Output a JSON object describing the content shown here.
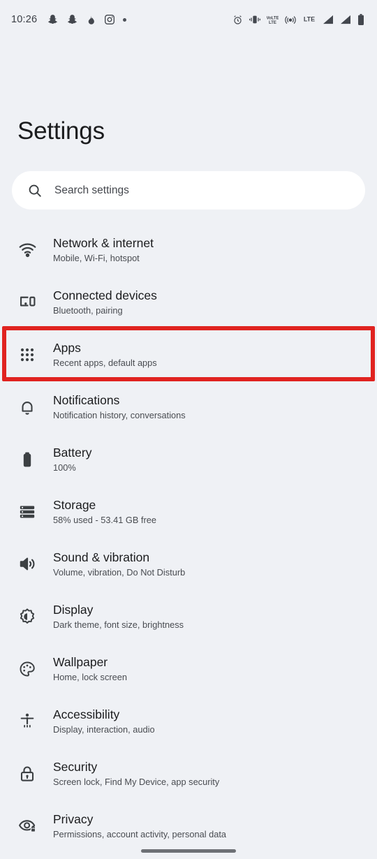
{
  "status_bar": {
    "clock": "10:26",
    "left_icons": [
      "snapchat-icon",
      "snapchat-icon",
      "flame-icon",
      "instagram-icon",
      "dot-icon"
    ],
    "right_icons": [
      "alarm-icon",
      "vibrate-icon",
      "volte-icon",
      "hotspot-icon",
      "lte-label-icon",
      "signal-bars-icon",
      "signal-bars-icon",
      "battery-icon"
    ],
    "volte_label": "VoLTE",
    "lte_label": "LTE"
  },
  "header": {
    "title": "Settings"
  },
  "search": {
    "placeholder": "Search settings",
    "value": "",
    "icon": "search-icon"
  },
  "settings_list": [
    {
      "icon": "wifi-icon",
      "title": "Network & internet",
      "subtitle": "Mobile, Wi-Fi, hotspot",
      "highlighted": false
    },
    {
      "icon": "devices-icon",
      "title": "Connected devices",
      "subtitle": "Bluetooth, pairing",
      "highlighted": false
    },
    {
      "icon": "apps-grid-icon",
      "title": "Apps",
      "subtitle": "Recent apps, default apps",
      "highlighted": true
    },
    {
      "icon": "bell-icon",
      "title": "Notifications",
      "subtitle": "Notification history, conversations",
      "highlighted": false
    },
    {
      "icon": "battery-icon",
      "title": "Battery",
      "subtitle": "100%",
      "highlighted": false
    },
    {
      "icon": "storage-icon",
      "title": "Storage",
      "subtitle": "58% used - 53.41 GB free",
      "highlighted": false
    },
    {
      "icon": "volume-icon",
      "title": "Sound & vibration",
      "subtitle": "Volume, vibration, Do Not Disturb",
      "highlighted": false
    },
    {
      "icon": "brightness-icon",
      "title": "Display",
      "subtitle": "Dark theme, font size, brightness",
      "highlighted": false
    },
    {
      "icon": "palette-icon",
      "title": "Wallpaper",
      "subtitle": "Home, lock screen",
      "highlighted": false
    },
    {
      "icon": "accessibility-icon",
      "title": "Accessibility",
      "subtitle": "Display, interaction, audio",
      "highlighted": false
    },
    {
      "icon": "lock-icon",
      "title": "Security",
      "subtitle": "Screen lock, Find My Device, app security",
      "highlighted": false
    },
    {
      "icon": "eye-lock-icon",
      "title": "Privacy",
      "subtitle": "Permissions, account activity, personal data",
      "highlighted": false
    }
  ],
  "navigation": {
    "home_indicator": "home-indicator"
  },
  "colors": {
    "background": "#eff1f5",
    "surface": "#ffffff",
    "highlight_border": "#e02320",
    "text_primary": "#1b1c1e",
    "text_secondary": "#494c51",
    "icon": "#3c4043"
  }
}
